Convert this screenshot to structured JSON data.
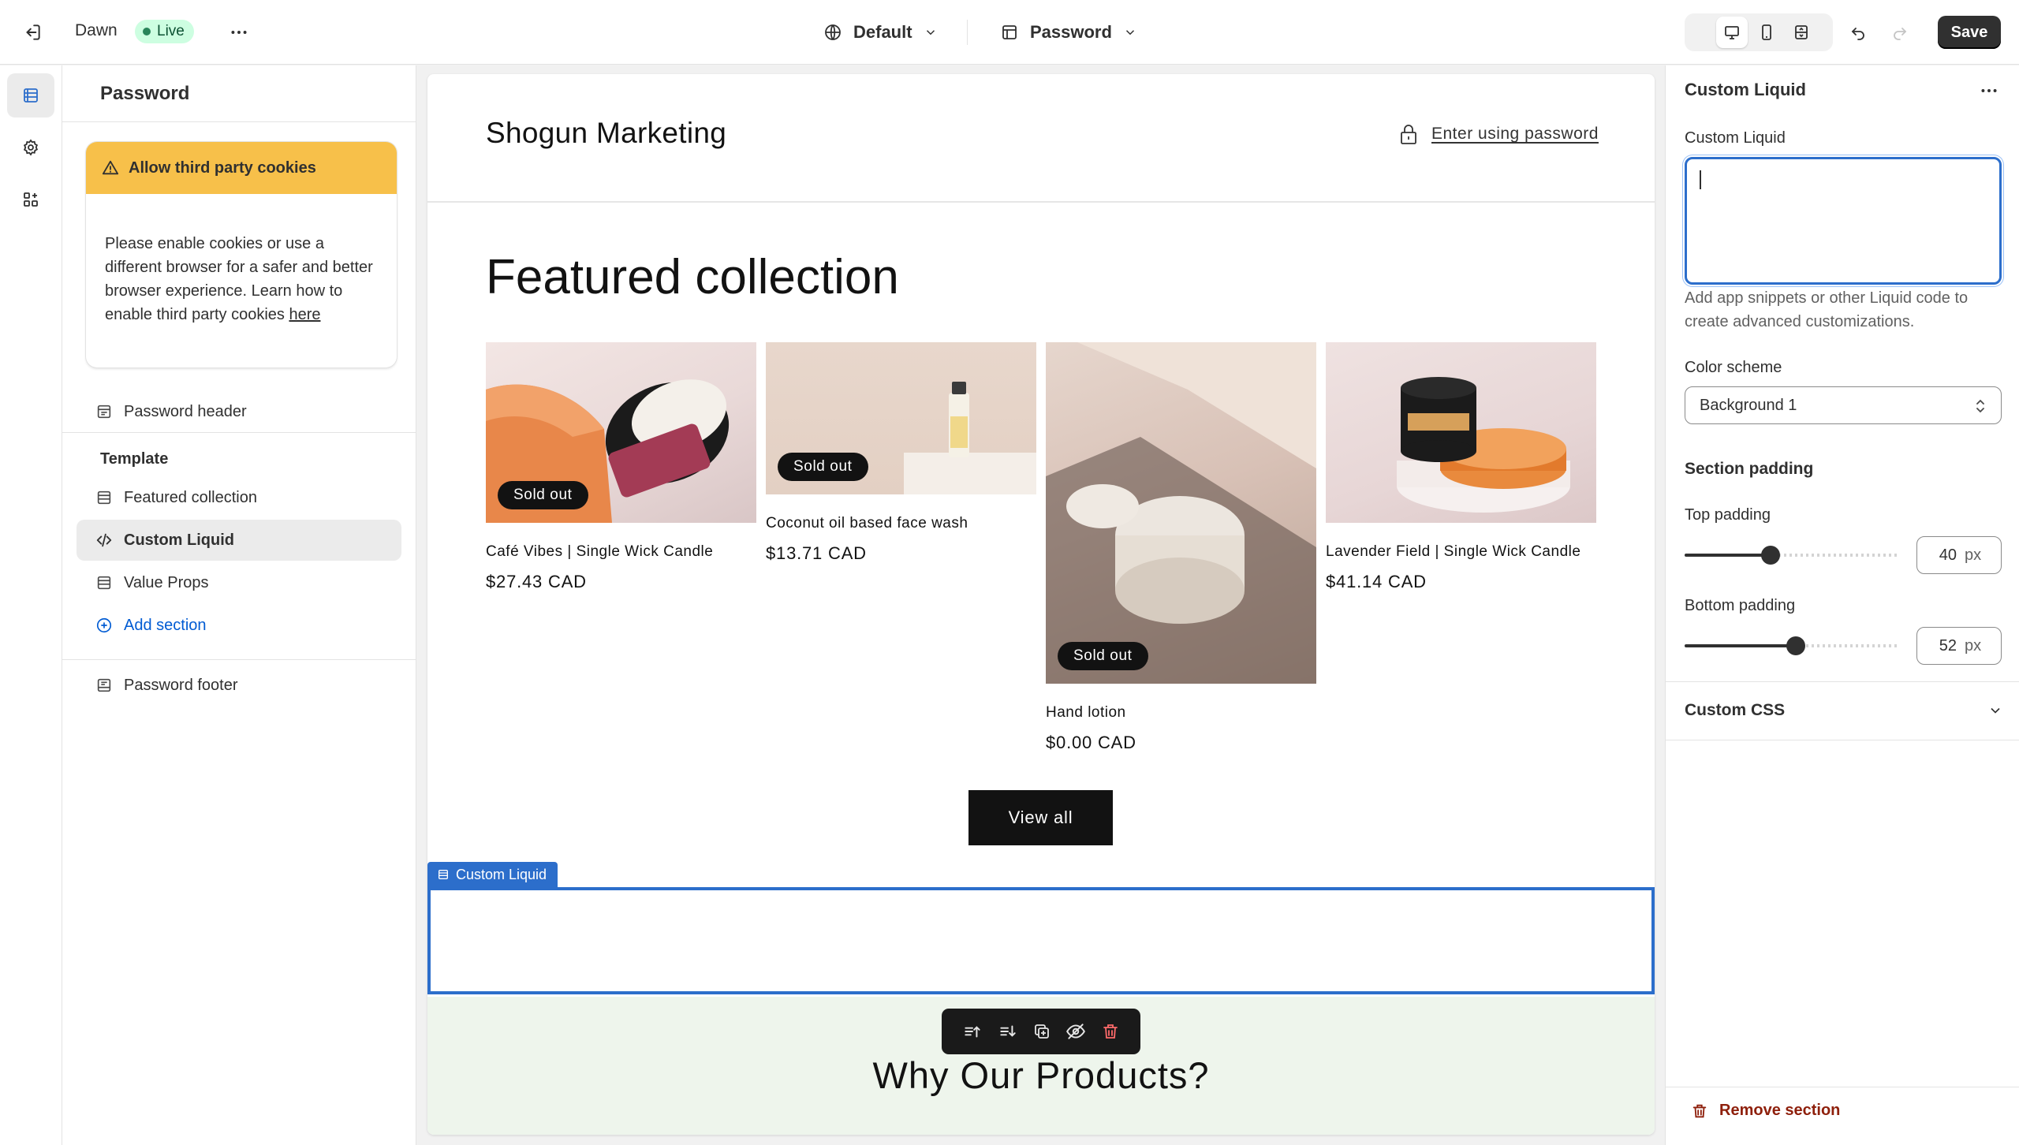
{
  "topbar": {
    "theme_name": "Dawn",
    "status": "Live",
    "preset_label": "Default",
    "template_label": "Password",
    "save_label": "Save"
  },
  "sidebar": {
    "title": "Password",
    "cookie_banner": {
      "title": "Allow third party cookies",
      "body": "Please enable cookies or use a different browser for a safer and better browser experience. Learn how to enable third party cookies ",
      "link": "here"
    },
    "header_item": "Password header",
    "template_label": "Template",
    "sections": [
      "Featured collection",
      "Custom Liquid",
      "Value Props"
    ],
    "add_section": "Add section",
    "footer_item": "Password footer"
  },
  "preview": {
    "store_name": "Shogun Marketing",
    "enter_password": "Enter using password",
    "collection_heading": "Featured collection",
    "products": [
      {
        "title": "Café Vibes | Single Wick Candle",
        "price": "$27.43 CAD",
        "badge": "Sold out"
      },
      {
        "title": "Coconut oil based face wash",
        "price": "$13.71 CAD",
        "badge": "Sold out"
      },
      {
        "title": "Hand lotion",
        "price": "$0.00 CAD",
        "badge": "Sold out"
      },
      {
        "title": "Lavender Field | Single Wick Candle",
        "price": "$41.14 CAD",
        "badge": ""
      }
    ],
    "view_all": "View all",
    "selected_section_tag": "Custom Liquid",
    "why_heading": "Why Our Products?"
  },
  "settings": {
    "title": "Custom Liquid",
    "field_label": "Custom Liquid",
    "field_value": "",
    "help_text": "Add app snippets or other Liquid code to create advanced customizations.",
    "color_scheme_label": "Color scheme",
    "color_scheme_value": "Background 1",
    "padding_heading": "Section padding",
    "top_padding_label": "Top padding",
    "top_padding_value": "40",
    "bottom_padding_label": "Bottom padding",
    "bottom_padding_value": "52",
    "unit": "px",
    "slider_max": 100,
    "custom_css_label": "Custom CSS",
    "remove_label": "Remove section"
  },
  "colors": {
    "accent_blue": "#2c6ecb",
    "warning_yellow": "#f7c04a",
    "live_green": "#cdfee1",
    "danger_red": "#8e1f0b"
  }
}
